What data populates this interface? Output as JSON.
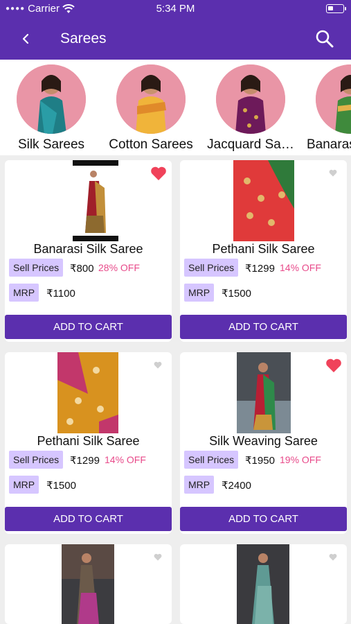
{
  "status": {
    "carrier": "Carrier",
    "time": "5:34 PM",
    "battery_level": 0.25
  },
  "header": {
    "title": "Sarees",
    "back_icon": "chevron-left-icon",
    "search_icon": "search-icon"
  },
  "categories": [
    {
      "label": "Silk Sarees"
    },
    {
      "label": "Cotton Sarees"
    },
    {
      "label": "Jacquard Sa…"
    },
    {
      "label": "Banaras"
    }
  ],
  "products": [
    {
      "name": "Banarasi Silk Saree",
      "sell_label": "Sell Prices",
      "price": "₹800",
      "off": "28% OFF",
      "mrp_label": "MRP",
      "mrp": "₹1100",
      "cart_label": "ADD TO CART",
      "favorited": true
    },
    {
      "name": "Pethani Silk Saree",
      "sell_label": "Sell Prices",
      "price": "₹1299",
      "off": "14% OFF",
      "mrp_label": "MRP",
      "mrp": "₹1500",
      "cart_label": "ADD TO CART",
      "favorited": false
    },
    {
      "name": "Pethani Silk Saree",
      "sell_label": "Sell Prices",
      "price": "₹1299",
      "off": "14% OFF",
      "mrp_label": "MRP",
      "mrp": "₹1500",
      "cart_label": "ADD TO CART",
      "favorited": false
    },
    {
      "name": "Silk Weaving Saree",
      "sell_label": "Sell Prices",
      "price": "₹1950",
      "off": "19% OFF",
      "mrp_label": "MRP",
      "mrp": "₹2400",
      "cart_label": "ADD TO CART",
      "favorited": true
    }
  ],
  "colors": {
    "primary": "#5b2fae",
    "tag_bg": "#d6c6ff",
    "discount": "#e84a8a",
    "heart_active": "#f0425a",
    "heart_inactive": "#cfcfcf"
  }
}
